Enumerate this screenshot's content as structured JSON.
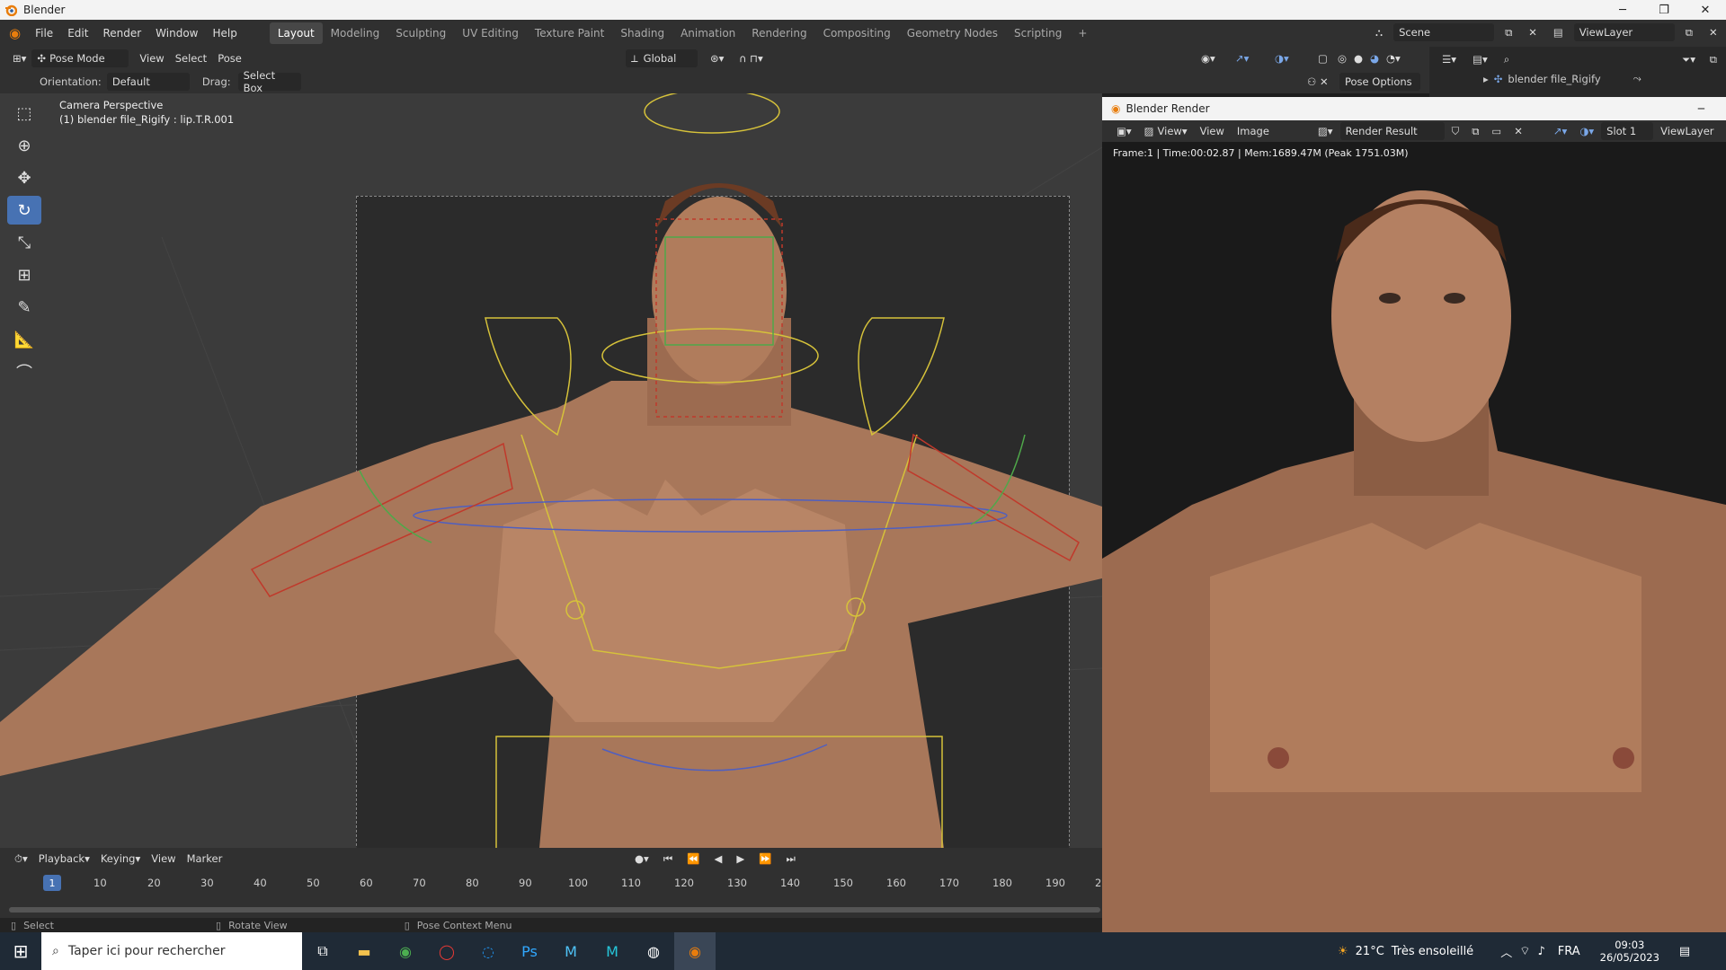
{
  "window": {
    "title": "Blender"
  },
  "menu": {
    "items": [
      "File",
      "Edit",
      "Render",
      "Window",
      "Help"
    ]
  },
  "workspaces": [
    "Layout",
    "Modeling",
    "Sculpting",
    "UV Editing",
    "Texture Paint",
    "Shading",
    "Animation",
    "Rendering",
    "Compositing",
    "Geometry Nodes",
    "Scripting"
  ],
  "active_workspace": "Layout",
  "scene": {
    "label": "Scene"
  },
  "viewlayer": {
    "label": "ViewLayer"
  },
  "header": {
    "mode": "Pose Mode",
    "view": "View",
    "select": "Select",
    "pose": "Pose",
    "transform": "Global",
    "orientation_label": "Orientation:",
    "orientation_value": "Default",
    "drag_label": "Drag:",
    "drag_value": "Select Box",
    "pose_options": "Pose Options"
  },
  "viewport": {
    "cam_title": "Camera Perspective",
    "cam_sub": "(1) blender file_Rigify : lip.T.R.001"
  },
  "outliner": {
    "item": "blender file_Rigify"
  },
  "render": {
    "title": "Blender Render",
    "view1": "View",
    "view2": "View",
    "image": "Image",
    "result": "Render Result",
    "slot": "Slot 1",
    "viewlayer": "ViewLayer",
    "info": "Frame:1 | Time:00:02.87 | Mem:1689.47M (Peak 1751.03M)"
  },
  "timeline": {
    "playback": "Playback",
    "keying": "Keying",
    "view": "View",
    "marker": "Marker",
    "current": "1",
    "ticks": [
      "10",
      "20",
      "30",
      "40",
      "50",
      "60",
      "70",
      "80",
      "90",
      "100",
      "110",
      "120",
      "130",
      "140",
      "150",
      "160",
      "170",
      "180",
      "190",
      "2"
    ]
  },
  "status": {
    "select": "Select",
    "rotate": "Rotate View",
    "context": "Pose Context Menu"
  },
  "taskbar": {
    "search": "Taper ici pour rechercher",
    "weather_temp": "21°C",
    "weather_text": "Très ensoleillé",
    "lang": "FRA",
    "time": "09:03",
    "date": "26/05/2023"
  },
  "colors": {
    "accent": "#4772b3",
    "bone_yellow": "#d6c23a",
    "bone_green": "#4fa84a",
    "bone_red": "#c0392b",
    "bone_blue": "#4f5fc0",
    "skin": "#b07c5c"
  }
}
